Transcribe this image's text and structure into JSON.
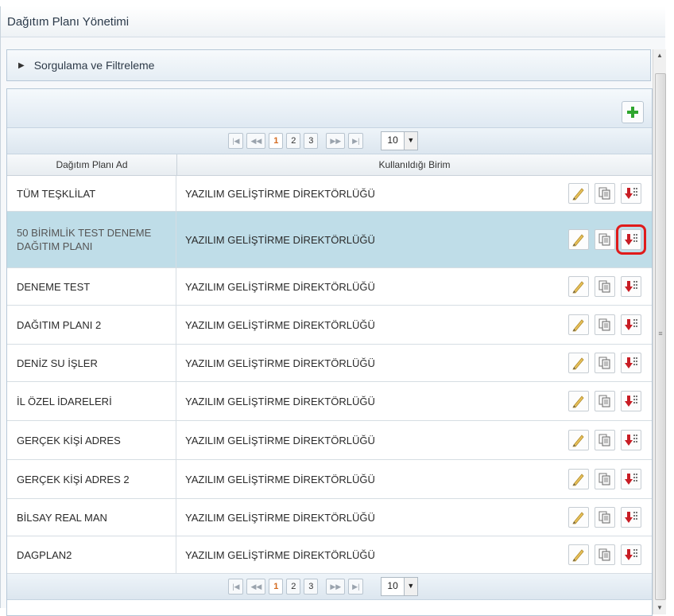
{
  "window": {
    "title": "Dağıtım Planı Yönetimi"
  },
  "filter": {
    "label": "Sorgulama ve Filtreleme"
  },
  "pager": {
    "first": "⏮",
    "prev": "◀◀",
    "pages": [
      "1",
      "2",
      "3"
    ],
    "active_page": "1",
    "next": "▶▶",
    "last": "▶|",
    "page_size": "10"
  },
  "table": {
    "headers": [
      "Dağıtım Planı Ad",
      "Kullanıldığı Birim"
    ],
    "rows": [
      {
        "name": "TÜM TEŞKLİLAT",
        "unit": "YAZILIM GELİŞTİRME DİREKTÖRLÜĞÜ"
      },
      {
        "name": "50 BİRİMLİK TEST DENEME DAĞITIM PLANI",
        "unit": "YAZILIM GELİŞTİRME DİREKTÖRLÜĞÜ"
      },
      {
        "name": "DENEME TEST",
        "unit": "YAZILIM GELİŞTİRME DİREKTÖRLÜĞÜ"
      },
      {
        "name": "DAĞITIM PLANI 2",
        "unit": "YAZILIM GELİŞTİRME DİREKTÖRLÜĞÜ"
      },
      {
        "name": "DENİZ SU İŞLER",
        "unit": "YAZILIM GELİŞTİRME DİREKTÖRLÜĞÜ"
      },
      {
        "name": "İL ÖZEL İDARELERİ",
        "unit": "YAZILIM GELİŞTİRME DİREKTÖRLÜĞÜ"
      },
      {
        "name": "GERÇEK KİŞİ ADRES",
        "unit": "YAZILIM GELİŞTİRME DİREKTÖRLÜĞÜ"
      },
      {
        "name": "GERÇEK KİŞİ ADRES 2",
        "unit": "YAZILIM GELİŞTİRME DİREKTÖRLÜĞÜ"
      },
      {
        "name": "BİLSAY REAL MAN",
        "unit": "YAZILIM GELİŞTİRME DİREKTÖRLÜĞÜ"
      },
      {
        "name": "DAGPLAN2",
        "unit": "YAZILIM GELİŞTİRME DİREKTÖRLÜĞÜ"
      }
    ]
  },
  "icons": {
    "add": "plus-icon",
    "edit": "pencil-icon",
    "copy": "copy-icon",
    "order": "sort-down-icon"
  },
  "colors": {
    "selected_row": "#bfdde8",
    "highlight": "#e01b1b",
    "add_green": "#2ea52e",
    "order_red": "#c81d25"
  }
}
